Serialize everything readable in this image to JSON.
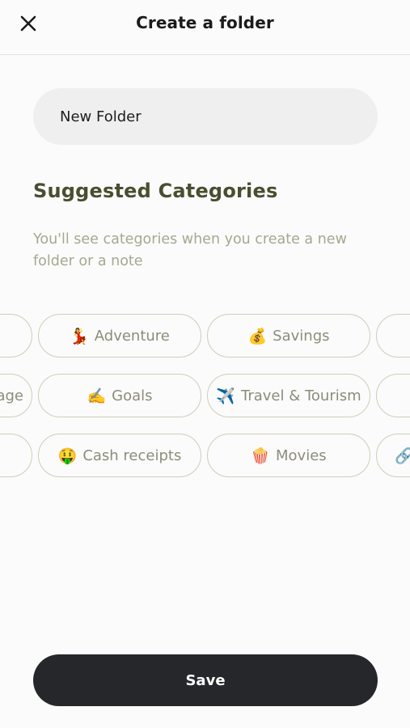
{
  "header": {
    "title": "Create a folder",
    "close_icon": "close-icon"
  },
  "folder_name": {
    "value": "New Folder",
    "placeholder": "Folder name"
  },
  "suggested": {
    "title": "Suggested Categories",
    "description": "You'll see categories when you create a new folder or a note"
  },
  "chips": {
    "row1": [
      {
        "emoji": "",
        "label": ""
      },
      {
        "emoji": "💃",
        "label": "Adventure"
      },
      {
        "emoji": "💰",
        "label": "Savings"
      },
      {
        "emoji": "",
        "label": ""
      }
    ],
    "row2": [
      {
        "emoji": "",
        "label": "age"
      },
      {
        "emoji": "✍️",
        "label": "Goals"
      },
      {
        "emoji": "✈️",
        "label": "Travel & Tourism"
      },
      {
        "emoji": "",
        "label": ""
      }
    ],
    "row3": [
      {
        "emoji": "",
        "label": ""
      },
      {
        "emoji": "🤑",
        "label": "Cash receipts"
      },
      {
        "emoji": "🍿",
        "label": "Movies"
      },
      {
        "emoji": "🔗",
        "label": ""
      }
    ]
  },
  "save_button": {
    "label": "Save"
  },
  "colors": {
    "title_olive": "#4a4e30",
    "muted_text": "#a6a890",
    "chip_border": "#cfcdb8",
    "save_bg": "#26272b"
  }
}
